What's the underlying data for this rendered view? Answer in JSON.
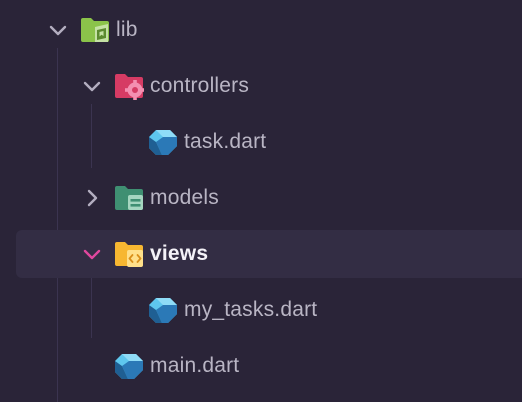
{
  "colors": {
    "background": "#2a2438",
    "selected_row": "#332d44",
    "label": "#b9b5c4",
    "label_active": "#f4f2f8",
    "chevron": "#b3aec0",
    "chevron_active": "#e0479e",
    "lib_folder": "#8bc34a",
    "controllers_folder": "#d63b64",
    "models_folder": "#3f8f72",
    "views_folder": "#f7b731",
    "dart_light": "#5ec7ee",
    "dart_dark": "#2b79b7"
  },
  "tree": {
    "lib": {
      "label": "lib",
      "icon": "folder-lib-icon",
      "expanded": true
    },
    "controllers": {
      "label": "controllers",
      "icon": "folder-controllers-icon",
      "expanded": true
    },
    "task": {
      "label": "task.dart",
      "icon": "dart-file-icon"
    },
    "models": {
      "label": "models",
      "icon": "folder-models-icon",
      "expanded": false
    },
    "views": {
      "label": "views",
      "icon": "folder-views-icon",
      "expanded": true,
      "selected": true
    },
    "my_tasks": {
      "label": "my_tasks.dart",
      "icon": "dart-file-icon"
    },
    "main": {
      "label": "main.dart",
      "icon": "dart-file-icon"
    }
  }
}
